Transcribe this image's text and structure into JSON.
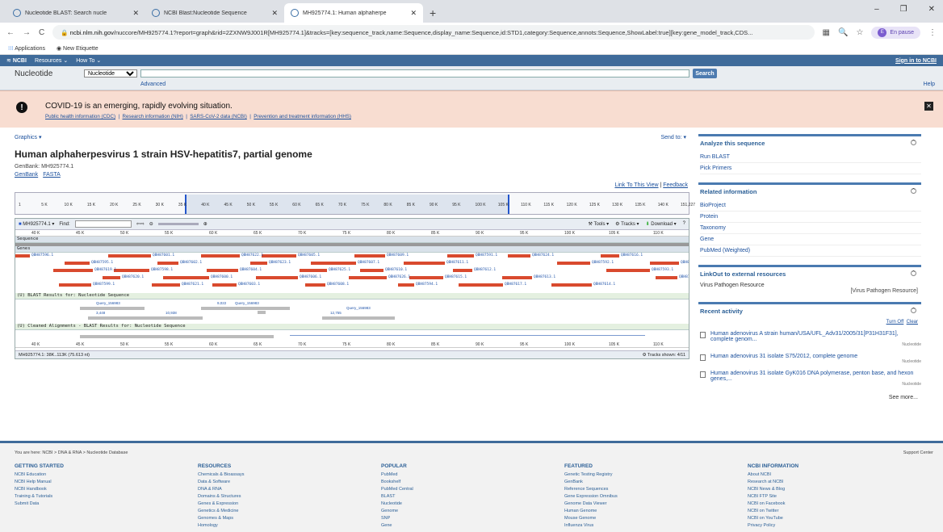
{
  "browser": {
    "tabs": [
      {
        "label": "Nucleotide BLAST: Search nucle"
      },
      {
        "label": "NCBI Blast:Nucleotide Sequence"
      },
      {
        "label": "MH925774.1: Human alphaherpe"
      }
    ],
    "url_host": "ncbi.nlm.nih.gov",
    "url_rest": "/nuccore/MH925774.1?report=graph&rid=2ZXNW9J001R[MH925774.1]&tracks=[key:sequence_track,name:Sequence,display_name:Sequence,id:STD1,category:Sequence,annots:Sequence,ShowLabel:true][key:gene_model_track,CDS...",
    "profile_initial": "E",
    "profile_label": "En pause",
    "bookmarks": [
      "Applications",
      "New Etiquette"
    ]
  },
  "ncbi": {
    "logo": "NCBI",
    "resources": "Resources",
    "howto": "How To",
    "signin": "Sign in to NCBI",
    "db_label": "Nucleotide",
    "db_selected": "Nucleotide",
    "search_btn": "Search",
    "advanced": "Advanced",
    "help": "Help"
  },
  "covid": {
    "title": "COVID-19 is an emerging, rapidly evolving situation.",
    "links": [
      "Public health information (CDC)",
      "Research information (NIH)",
      "SARS-CoV-2 data (NCBI)",
      "Prevention and treatment information (HHS)"
    ]
  },
  "record": {
    "graphics": "Graphics",
    "sendto": "Send to:",
    "title": "Human alphaherpesvirus 1 strain HSV-hepatitis7, partial genome",
    "genbank": "GenBank: MH925774.1",
    "formats": [
      "GenBank",
      "FASTA"
    ],
    "link_view": "Link To This View",
    "feedback": "Feedback"
  },
  "viewer": {
    "ruler_ticks": [
      "1",
      "5 K",
      "10 K",
      "15 K",
      "20 K",
      "25 K",
      "30 K",
      "35 K",
      "40 K",
      "45 K",
      "50 K",
      "55 K",
      "60 K",
      "65 K",
      "70 K",
      "75 K",
      "80 K",
      "85 K",
      "90 K",
      "95 K",
      "100 K",
      "105 K",
      "110 K",
      "115 K",
      "120 K",
      "125 K",
      "130 K",
      "135 K",
      "140 K",
      "151,227"
    ],
    "seq_id": "MH925774.1",
    "find": "Find:",
    "tools": "Tools",
    "tracks": "Tracks",
    "download": "Download",
    "scale_ticks": [
      "40 K",
      "45 K",
      "50 K",
      "55 K",
      "60 K",
      "65 K",
      "70 K",
      "75 K",
      "80 K",
      "85 K",
      "90 K",
      "95 K",
      "100 K",
      "105 K",
      "110 K"
    ],
    "track_sequence": "Sequence",
    "track_genes": "Genes",
    "track_blast": "(U) BLAST Results for: Nucleotide Sequence",
    "track_cleaned": "(U) Cleaned Alignments - BLAST Results for: Nucleotide Sequence",
    "gene_labels": [
      "QBH87596.1",
      "QBH87595.1",
      "QBH87598.1",
      "QBH87600.1",
      "QBH87603.1",
      "QBH87605.1",
      "QBH87607.1",
      "QBH87610.1",
      "QBH87615.1",
      "QBH87617.1",
      "QBH87624.1",
      "QBH87592.1",
      "QBH87593.1",
      "QBH87597.1",
      "QBH87599.1",
      "QBH87601.1",
      "QBH87602.1",
      "QBH87604.1",
      "QBH87606.1",
      "QBH87608.1",
      "QBH87609.1",
      "QBH87611.1",
      "QBH87612.1",
      "QBH87613.1",
      "QBH87614.1",
      "QBH87616.1",
      "QBH87618.1",
      "QBH87619.1",
      "QBH87620.1",
      "QBH87621.1",
      "QBH87622.1",
      "QBH87623.1",
      "QBH87625.1",
      "QBH87626.1",
      "QBH87594.1",
      "QBH87591.1"
    ],
    "blast_labels": [
      "Query_156983",
      "11,604",
      "9,022",
      "6,720",
      "Query_156983",
      "3,448",
      "10,938",
      "12,755",
      "Query_156983"
    ],
    "status": "MH925774.1: 38K..113K (75.613 nt)",
    "tracks_shown": "Tracks shown: 4/11"
  },
  "sidebar": {
    "analyze": {
      "title": "Analyze this sequence",
      "items": [
        "Run BLAST",
        "Pick Primers"
      ]
    },
    "related": {
      "title": "Related information",
      "items": [
        "BioProject",
        "Protein",
        "Taxonomy",
        "Gene",
        "PubMed (Weighted)"
      ]
    },
    "linkout": {
      "title": "LinkOut to external resources",
      "item": "Virus Pathogen Resource",
      "bracket": "[Virus Pathogen Resource]"
    },
    "recent": {
      "title": "Recent activity",
      "turn_off": "Turn Off",
      "clear": "Clear",
      "items": [
        {
          "text": "Human adenovirus A strain human/USA/UFL_Adv31/2005/31[P31H31F31], complete genom...",
          "src": "Nucleotide"
        },
        {
          "text": "Human adenovirus 31 isolate S75/2012, complete genome",
          "src": "Nucleotide"
        },
        {
          "text": "Human adenovirus 31 isolate GyK016 DNA polymerase, penton base, and hexon genes,...",
          "src": "Nucleotide"
        }
      ],
      "see_more": "See more..."
    }
  },
  "footer": {
    "crumb": "You are here: NCBI > DNA & RNA > Nucleotide Database",
    "support": "Support Center",
    "cols": [
      {
        "title": "GETTING STARTED",
        "items": [
          "NCBI Education",
          "NCBI Help Manual",
          "NCBI Handbook",
          "Training & Tutorials",
          "Submit Data"
        ]
      },
      {
        "title": "RESOURCES",
        "items": [
          "Chemicals & Bioassays",
          "Data & Software",
          "DNA & RNA",
          "Domains & Structures",
          "Genes & Expression",
          "Genetics & Medicine",
          "Genomes & Maps",
          "Homology"
        ]
      },
      {
        "title": "POPULAR",
        "items": [
          "PubMed",
          "Bookshelf",
          "PubMed Central",
          "BLAST",
          "Nucleotide",
          "Genome",
          "SNP",
          "Gene"
        ]
      },
      {
        "title": "FEATURED",
        "items": [
          "Genetic Testing Registry",
          "GenBank",
          "Reference Sequences",
          "Gene Expression Omnibus",
          "Genome Data Viewer",
          "Human Genome",
          "Mouse Genome",
          "Influenza Virus"
        ]
      },
      {
        "title": "NCBI INFORMATION",
        "items": [
          "About NCBI",
          "Research at NCBI",
          "NCBI News & Blog",
          "NCBI FTP Site",
          "NCBI on Facebook",
          "NCBI on Twitter",
          "NCBI on YouTube",
          "Privacy Policy"
        ]
      }
    ]
  }
}
